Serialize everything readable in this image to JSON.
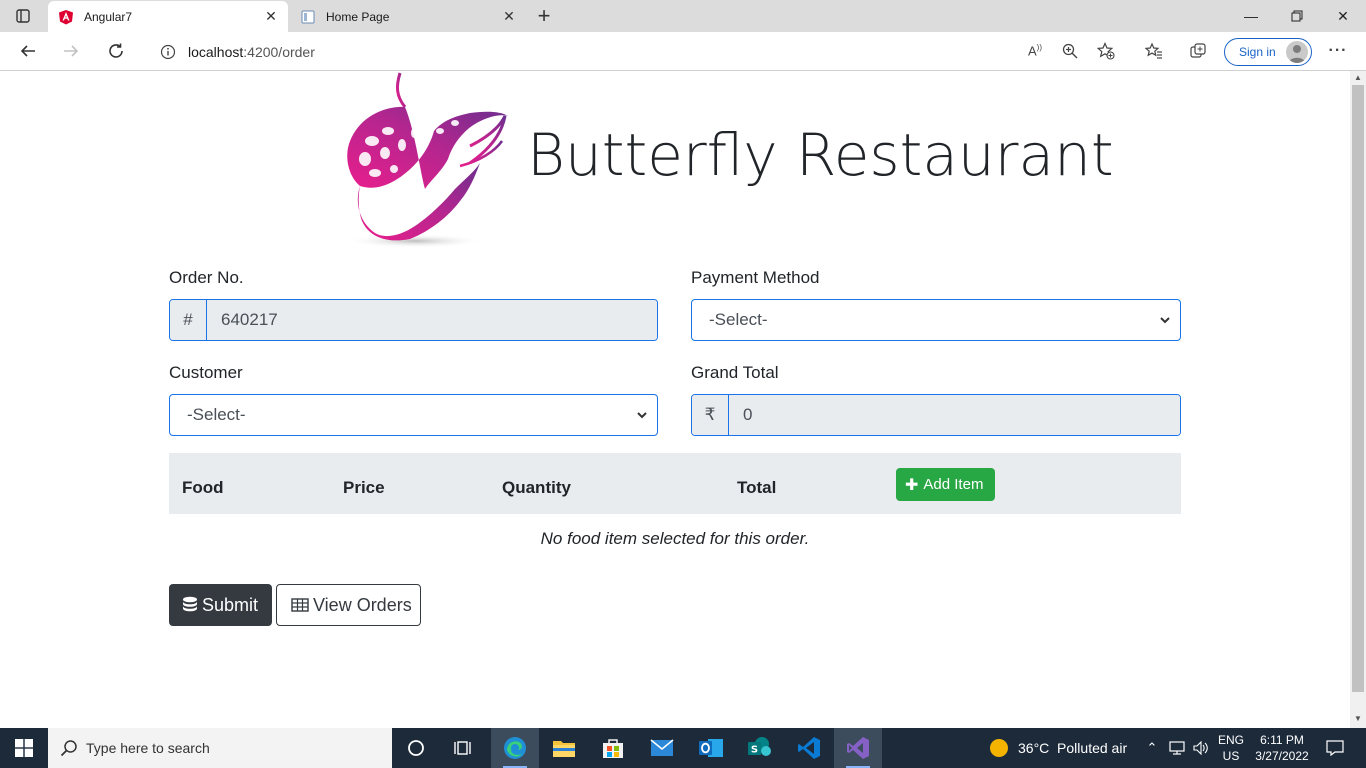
{
  "browser": {
    "tabs": [
      {
        "title": "Angular7",
        "icon": "angular-icon",
        "active": true
      },
      {
        "title": "Home Page",
        "icon": "page-icon",
        "active": false
      }
    ],
    "address": {
      "host": "localhost",
      "path": ":4200/order"
    },
    "signin_label": "Sign in"
  },
  "page": {
    "brand_title": "Butterfly Restaurant",
    "form": {
      "order_no_label": "Order No.",
      "order_no_prefix": "#",
      "order_no_value": "640217",
      "payment_label": "Payment Method",
      "payment_selected": "-Select-",
      "customer_label": "Customer",
      "customer_selected": "-Select-",
      "grand_total_label": "Grand Total",
      "grand_total_prefix": "₹",
      "grand_total_value": "0"
    },
    "table": {
      "headers": [
        "Food",
        "Price",
        "Quantity",
        "Total"
      ],
      "add_item_label": "Add Item",
      "empty_message": "No food item selected for this order."
    },
    "buttons": {
      "submit_label": "Submit",
      "view_orders_label": "View Orders"
    }
  },
  "taskbar": {
    "search_placeholder": "Type here to search",
    "weather": "36°C  Polluted air",
    "lang_top": "ENG",
    "lang_bottom": "US",
    "time": "6:11 PM",
    "date": "3/27/2022"
  },
  "colors": {
    "accent_blue": "#1a73e8",
    "add_green": "#28a745",
    "dark_button": "#343a40",
    "brand_magenta": "#c2187a",
    "brand_purple": "#6b2f8f"
  }
}
